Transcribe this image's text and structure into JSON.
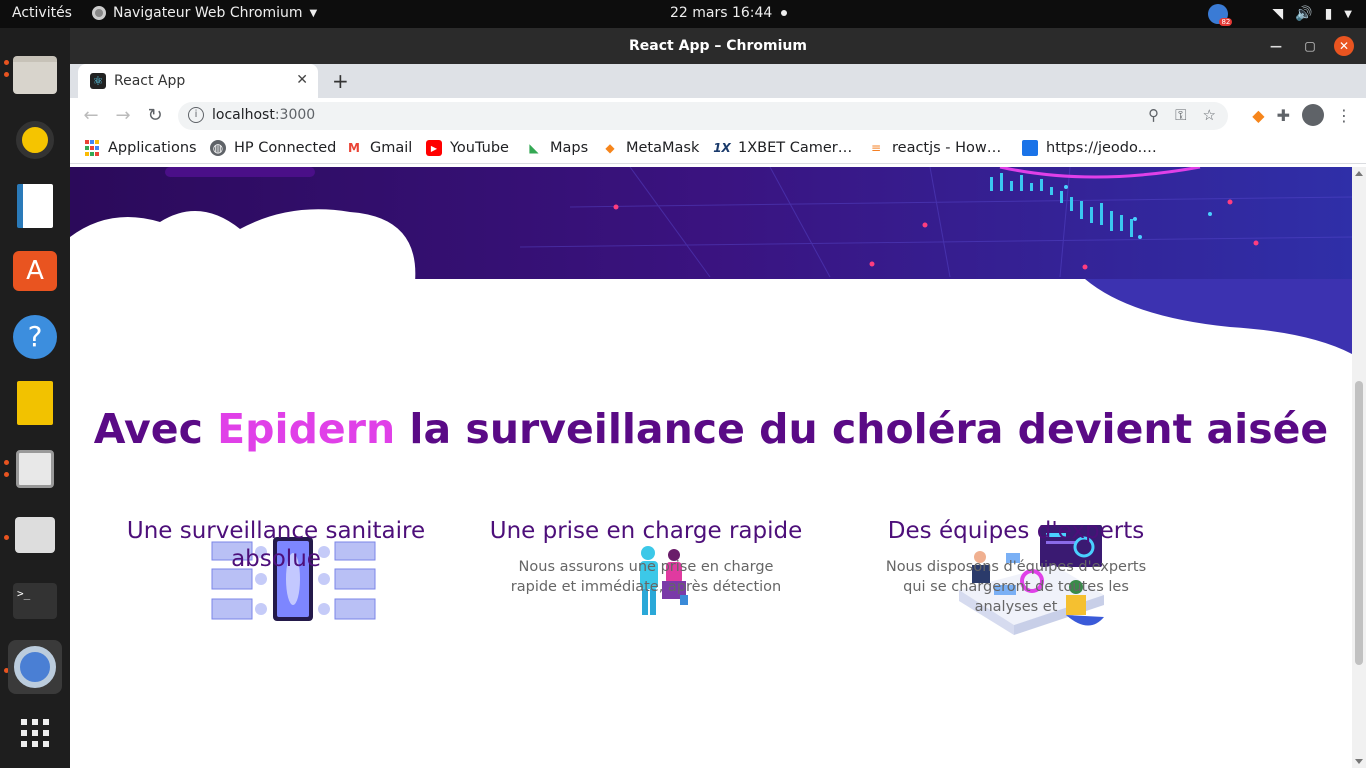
{
  "topbar": {
    "activities": "Activités",
    "app_menu": "Navigateur Web Chromium",
    "clock": "22 mars  16:44",
    "notification_count": "82"
  },
  "window": {
    "title": "React App – Chromium"
  },
  "tab": {
    "title": "React App"
  },
  "address_bar": {
    "host": "localhost",
    "port": ":3000"
  },
  "bookmarks": [
    {
      "label": "Applications",
      "icon": "apps-grid-icon",
      "color": "#4285f4"
    },
    {
      "label": "HP Connected",
      "icon": "globe-icon",
      "color": "#5f6368"
    },
    {
      "label": "Gmail",
      "icon": "gmail-icon",
      "color": "#ea4335"
    },
    {
      "label": "YouTube",
      "icon": "youtube-icon",
      "color": "#ff0000"
    },
    {
      "label": "Maps",
      "icon": "maps-icon",
      "color": "#34a853"
    },
    {
      "label": "MetaMask",
      "icon": "metamask-icon",
      "color": "#f6851b"
    },
    {
      "label": "1XBET Camer…",
      "icon": "1xbet-icon",
      "color": "#1a3a6b"
    },
    {
      "label": "reactjs - How…",
      "icon": "stackoverflow-icon",
      "color": "#f48024"
    },
    {
      "label": "https://jeodo.…",
      "icon": "page-icon",
      "color": "#1a73e8"
    }
  ],
  "page": {
    "headline_before": "Avec ",
    "headline_accent": "Epidern",
    "headline_after": " la surveillance du choléra devient aisée",
    "colors": {
      "primary": "#5a0a86",
      "accent": "#e040e8",
      "hero": "#2a0a5e"
    },
    "features": [
      {
        "title": "Une surveillance sanitaire absolue",
        "desc": ""
      },
      {
        "title": "Une prise en charge rapide",
        "desc": "Nous assurons une prise en charge rapide et immédiate, après détection"
      },
      {
        "title": "Des équipes d'experts",
        "desc": "Nous disposons d'équipes d'experts qui se chargeront de toutes les analyses et"
      }
    ]
  }
}
